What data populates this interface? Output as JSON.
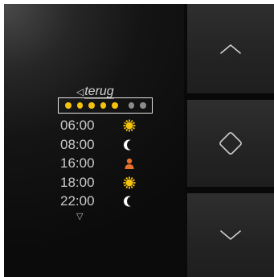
{
  "display": {
    "back_label": "terug",
    "back_arrow": "◁",
    "more_arrow": "▽",
    "day_dots": [
      {
        "active": true
      },
      {
        "active": true
      },
      {
        "active": true
      },
      {
        "active": true
      },
      {
        "active": true
      },
      {
        "active": false
      },
      {
        "active": false
      }
    ],
    "schedule": [
      {
        "time": "06:00",
        "icon": "sun-icon"
      },
      {
        "time": "08:00",
        "icon": "moon-icon"
      },
      {
        "time": "16:00",
        "icon": "person-icon"
      },
      {
        "time": "18:00",
        "icon": "sun-icon"
      },
      {
        "time": "22:00",
        "icon": "moon-icon"
      }
    ]
  },
  "buttons": {
    "up_icon": "chevron-up-icon",
    "home_icon": "diamond-icon",
    "down_icon": "chevron-down-icon"
  },
  "colors": {
    "accent_yellow": "#f4c20d",
    "inactive_dot": "#8c8c8c",
    "person_orange": "#e8702a",
    "moon_white": "#ffffff"
  }
}
